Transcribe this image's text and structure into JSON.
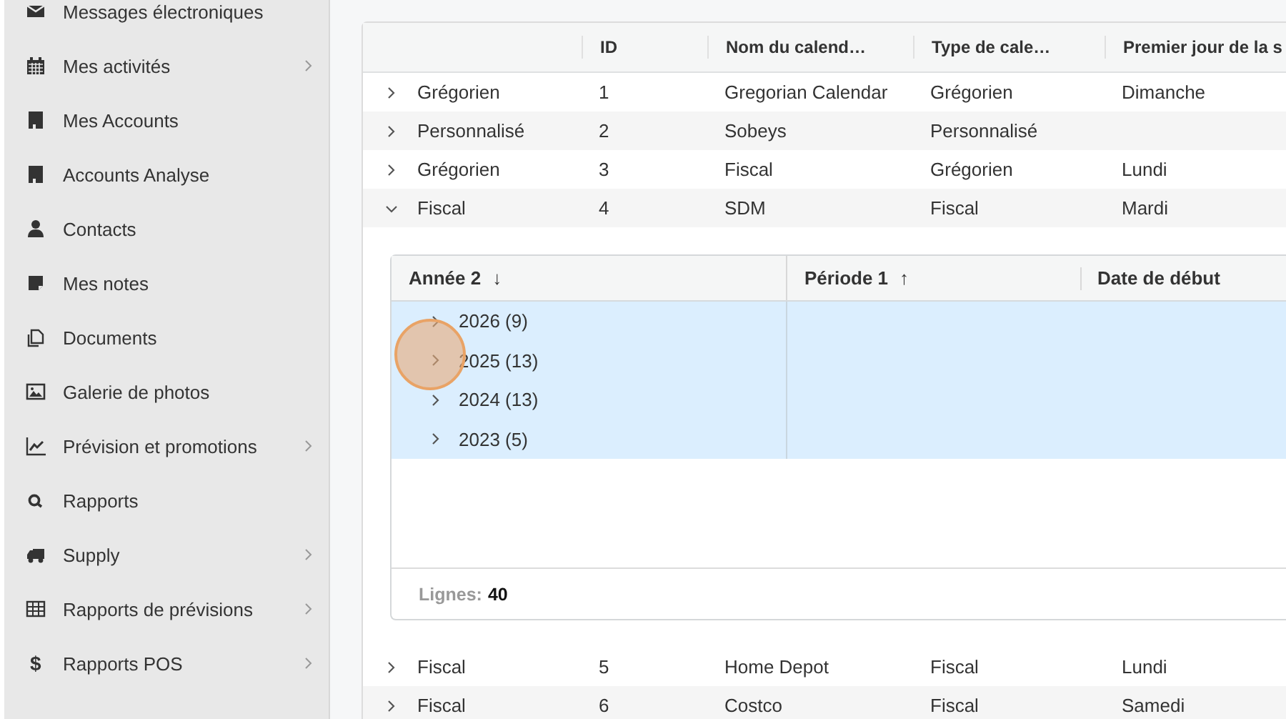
{
  "sidebar": {
    "items": [
      {
        "label": "Messages électroniques",
        "kind": "envelope",
        "submenu": false
      },
      {
        "label": "Mes activités",
        "kind": "calendar",
        "submenu": true
      },
      {
        "label": "Mes Accounts",
        "kind": "building",
        "submenu": false
      },
      {
        "label": "Accounts Analyse",
        "kind": "building",
        "submenu": false
      },
      {
        "label": "Contacts",
        "kind": "person",
        "submenu": false
      },
      {
        "label": "Mes notes",
        "kind": "note",
        "submenu": false
      },
      {
        "label": "Documents",
        "kind": "documents",
        "submenu": false
      },
      {
        "label": "Galerie de photos",
        "kind": "image",
        "submenu": false
      },
      {
        "label": "Prévision et promotions",
        "kind": "chart",
        "submenu": true
      },
      {
        "label": "Rapports",
        "kind": "search",
        "submenu": false
      },
      {
        "label": "Supply",
        "kind": "truck",
        "submenu": true
      },
      {
        "label": "Rapports de prévisions",
        "kind": "table",
        "submenu": true
      },
      {
        "label": "Rapports POS",
        "kind": "glyph",
        "glyph": "$",
        "submenu": true
      }
    ]
  },
  "table": {
    "columns": [
      "ID",
      "Nom du calend…",
      "Type de cale…",
      "Premier jour de la s"
    ],
    "rows": [
      {
        "column_1": "Grégorien",
        "id": "1",
        "calendar_name": "Gregorian Calendar",
        "calendar_type": "Grégorien",
        "first_day": "Dimanche",
        "expanded": false
      },
      {
        "column_1": "Personnalisé",
        "id": "2",
        "calendar_name": "Sobeys",
        "calendar_type": "Personnalisé",
        "expanded": false
      },
      {
        "column_1": "Grégorien",
        "id": "3",
        "calendar_name": "Fiscal",
        "calendar_type": "Grégorien",
        "first_day": "Lundi",
        "expanded": false
      },
      {
        "column_1": "Fiscal",
        "id": "4",
        "calendar_name": "SDM",
        "calendar_type": "Fiscal",
        "first_day": "Mardi",
        "expanded": true,
        "detail": {
          "columns": [
            {
              "label": "Année",
              "sort_order": "2",
              "sort_arrow": "↓"
            },
            {
              "label": "Période",
              "sort_order": "1",
              "sort_arrow": "↑"
            },
            {
              "label": "Date de début"
            }
          ],
          "groups": [
            {
              "year": "2026",
              "count": "(9)",
              "expanded": false,
              "selected": true
            },
            {
              "year": "2025",
              "count": "(13)",
              "expanded": false,
              "selected": true
            },
            {
              "year": "2024",
              "count": "(13)",
              "expanded": false,
              "selected": true
            },
            {
              "year": "2023",
              "count": "(5)",
              "expanded": false,
              "selected": true
            }
          ],
          "footer": {
            "label": "Lignes:",
            "value": "40"
          }
        }
      },
      {
        "column_1": "Fiscal",
        "id": "5",
        "calendar_name": "Home Depot",
        "calendar_type": "Fiscal",
        "first_day": "Lundi",
        "expanded": false
      },
      {
        "column_1": "Fiscal",
        "id": "6",
        "calendar_name": "Costco",
        "calendar_type": "Fiscal",
        "first_day": "Samedi",
        "expanded": false
      }
    ]
  }
}
